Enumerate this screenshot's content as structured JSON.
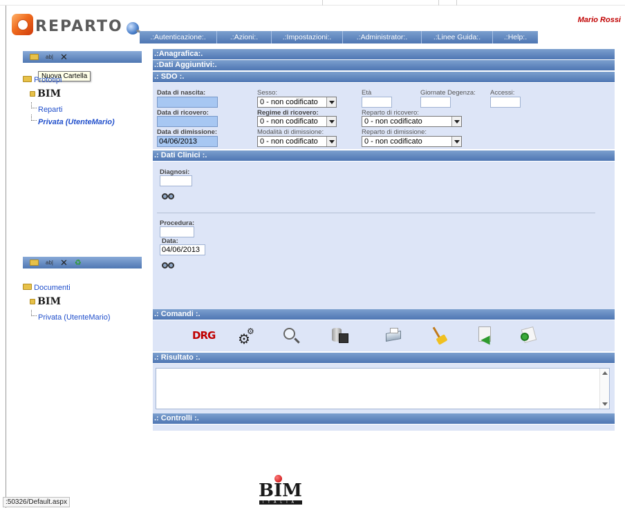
{
  "app": {
    "logo_text": "REPARTO",
    "user": "Mario Rossi"
  },
  "menu": [
    ".:Autenticazione:.",
    ".:Azioni:.",
    ".:Impostazioni:.",
    ".:Administrator:.",
    ".:Linee Guida:.",
    ".:Help:."
  ],
  "left_panel": {
    "toolbar_top": {
      "folder_icon": "folder-icon",
      "rename_label": "ab|",
      "delete_icon": "close-icon"
    },
    "tooltip": "Nuova Cartella",
    "tree1": {
      "root": "Prototipi",
      "org": "BIM",
      "items": [
        "Reparti",
        "Privata (UtenteMario)"
      ]
    },
    "tree2": {
      "root": "Documenti",
      "org": "BIM",
      "items": [
        "Privata (UtenteMario)"
      ]
    }
  },
  "sections": {
    "anagrafica": ".:Anagrafica:.",
    "dati_aggiuntivi": ".:Dati Aggiuntivi:.",
    "sdo": ".: SDO :.",
    "dati_clinici": ".: Dati Clinici :.",
    "comandi": ".: Comandi :.",
    "risultato": ".: Risultato :.",
    "controlli": ".: Controlli :."
  },
  "sdo": {
    "data_nascita_label": "Data di nascita:",
    "data_nascita_value": "",
    "sesso_label": "Sesso:",
    "sesso_value": "0 - non codificato",
    "eta_label": "Età",
    "giornate_label": "Giornate Degenza:",
    "accessi_label": "Accessi:",
    "data_ricovero_label": "Data di ricovero:",
    "data_ricovero_value": "",
    "regime_label": "Regime di ricovero:",
    "regime_value": "0 - non codificato",
    "reparto_ricovero_label": "Reparto di ricovero:",
    "reparto_ricovero_value": "0 - non codificato",
    "data_dimissione_label": "Data di dimissione:",
    "data_dimissione_value": "04/06/2013",
    "modalita_label": "Modalità di dimissione:",
    "modalita_value": "0 - non codificato",
    "reparto_dimissione_label": "Reparto di dimissione:",
    "reparto_dimissione_value": "0 - non codificato"
  },
  "clinici": {
    "diagnosi_label": "Diagnosi:",
    "procedura_label": "Procedura:",
    "data_label": "Data:",
    "data_value": "04/06/2013"
  },
  "commands": [
    "drg-icon",
    "settings-gears-icon",
    "search-icon",
    "save-database-icon",
    "print-icon",
    "clear-broom-icon",
    "import-icon",
    "refresh-icon"
  ],
  "command_labels": {
    "drg": "DRG"
  },
  "footer": {
    "logo_text": "BIM",
    "logo_sub": "ITALIA"
  },
  "status_bar": ":50326/Default.aspx",
  "colors": {
    "header_blue": "#4e76b3",
    "panel_bg": "#dde5f7",
    "user_red": "#c00000",
    "link_blue": "#1f4ecb"
  }
}
